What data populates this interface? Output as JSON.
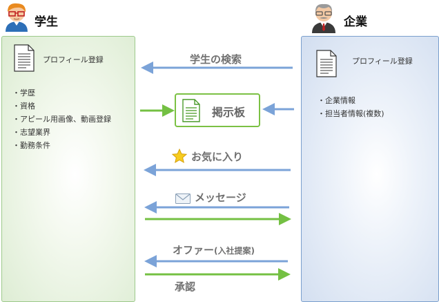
{
  "student": {
    "label": "学生",
    "doc_label": "プロフィール登録",
    "items": [
      "学歴",
      "資格",
      "アピール用画像、動画登録",
      "志望業界",
      "勤務条件"
    ]
  },
  "company": {
    "label": "企業",
    "doc_label": "プロフィール登録",
    "items": [
      "企業情報",
      "担当者情報(複数)"
    ]
  },
  "board": {
    "label": "掲示板"
  },
  "flows": {
    "search": "学生の検索",
    "favorite": "お気に入り",
    "message": "メッセージ",
    "offer_main": "オファー",
    "offer_sub": "(入社提案)",
    "approve": "承認"
  },
  "colors": {
    "blue_arrow": "#7ba3d8",
    "green_arrow": "#74c043",
    "green_border": "#9cc98a",
    "blue_border": "#7a9fcd"
  },
  "icons": [
    "student-avatar-icon",
    "company-avatar-icon",
    "document-icon",
    "star-icon",
    "envelope-icon"
  ]
}
